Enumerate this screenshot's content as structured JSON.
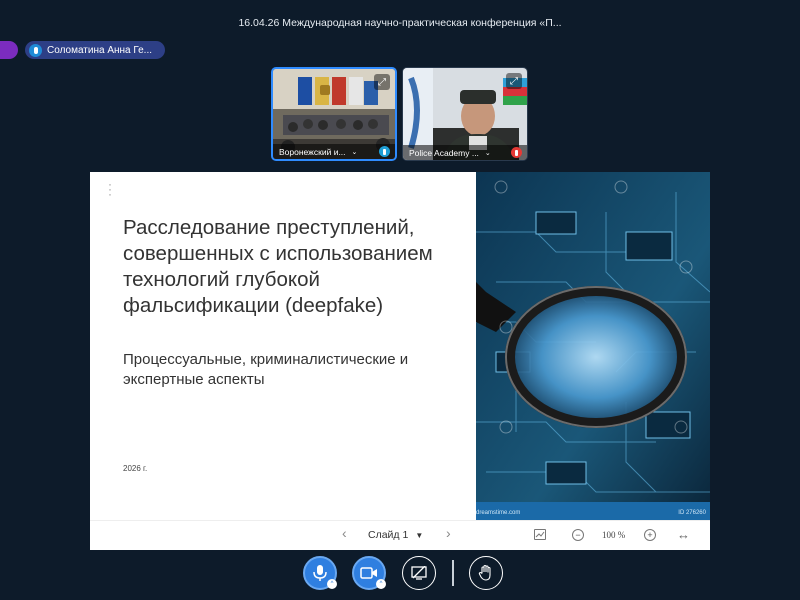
{
  "header": {
    "title": "16.04.26 Международная научно-практическая конференция «П..."
  },
  "speaker": {
    "name": "Соломатина Анна Ге..."
  },
  "participants": [
    {
      "label": "Воронежский и..."
    },
    {
      "label": "Police Academy ..."
    }
  ],
  "slide": {
    "title": "Расследование преступлений, совершенных с использованием технологий глубокой фальсификации (deepfake)",
    "subtitle": "Процессуальные, криминалистические и экспертные аспекты",
    "year": "2026 г.",
    "image_caption": "dreamstime.com",
    "image_id": "ID 276260"
  },
  "slide_controls": {
    "current_slide": "Слайд 1",
    "zoom": "100 %"
  },
  "colors": {
    "background": "#0d1b2a",
    "accent": "#2f7fe0",
    "speaker_chip": "#2d3f86"
  },
  "icons": [
    "microphone-icon",
    "camera-icon",
    "screen-share-icon",
    "raise-hand-icon",
    "expand-icon",
    "fit-width-icon",
    "presentation-icon"
  ]
}
